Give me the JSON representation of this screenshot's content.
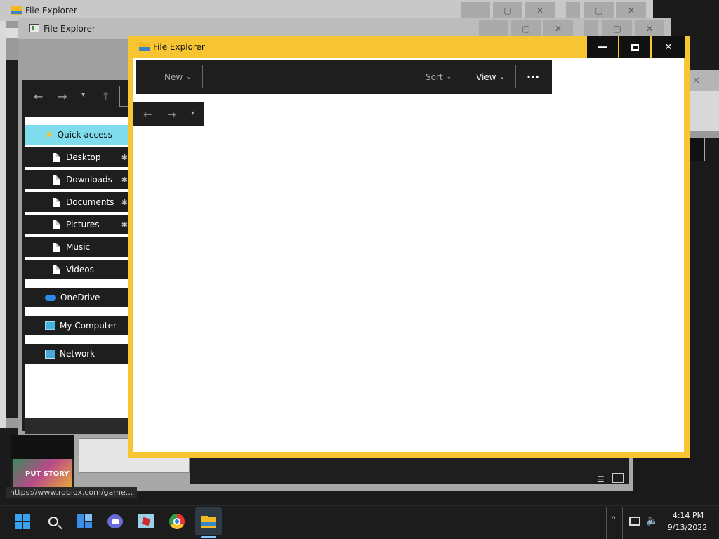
{
  "windows": {
    "back1": {
      "title": "File Explorer"
    },
    "back2": {
      "title": "File Explorer"
    },
    "front": {
      "title": "File Explorer",
      "toolbar": {
        "new_label": "New",
        "sort_label": "Sort",
        "view_label": "View",
        "more_label": "···"
      },
      "accent_color": "#f7c531"
    }
  },
  "navigation_pane": {
    "quick_access": "Quick access",
    "items": [
      {
        "label": "Desktop",
        "pinned": true
      },
      {
        "label": "Downloads",
        "pinned": true
      },
      {
        "label": "Documents",
        "pinned": true
      },
      {
        "label": "Pictures",
        "pinned": true
      },
      {
        "label": "Music",
        "pinned": false
      },
      {
        "label": "Videos",
        "pinned": false
      }
    ],
    "onedrive": "OneDrive",
    "my_computer": "My Computer",
    "network": "Network"
  },
  "status_url": "https://www.roblox.com/game...",
  "thumbnail_text": "PUT STORY",
  "taskbar": {
    "time": "4:14 PM",
    "date": "9/13/2022",
    "icons": [
      "start-icon",
      "search-icon",
      "widgets-icon",
      "meet-icon",
      "roblox-icon",
      "chrome-icon",
      "file-explorer-icon"
    ]
  }
}
